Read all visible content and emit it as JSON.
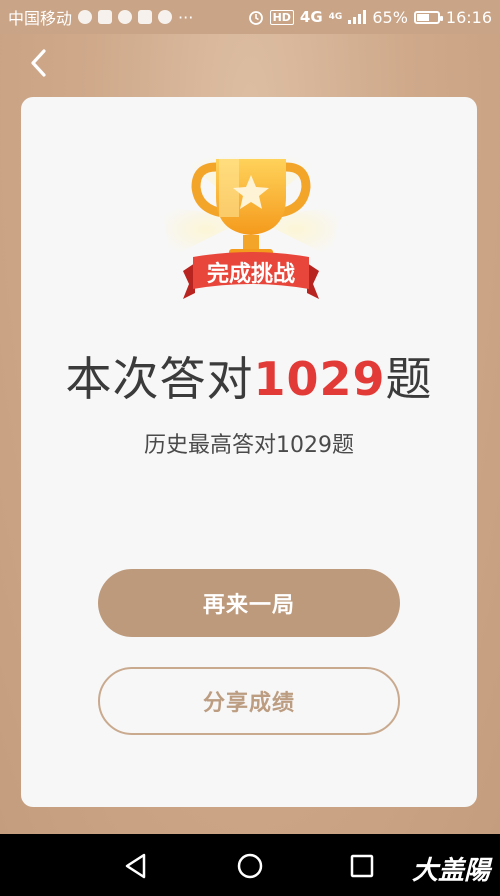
{
  "status_bar": {
    "carrier": "中国移动",
    "more": "···",
    "hd": "HD",
    "network": "4G",
    "network_small": "4G",
    "battery_percent": "65%",
    "battery_level": 0.65,
    "time": "16:16"
  },
  "result": {
    "badge_text": "完成挑战",
    "headline_prefix": "本次答对",
    "headline_count": "1029",
    "headline_suffix": "题",
    "history_text": "历史最高答对1029题"
  },
  "actions": {
    "replay_label": "再来一局",
    "share_label": "分享成绩"
  },
  "nav": {
    "back_icon": "chevron-left-icon",
    "system": [
      "back-triangle-icon",
      "home-circle-icon",
      "recent-square-icon"
    ]
  },
  "watermark": "大盖陽",
  "colors": {
    "background": "#c9a486",
    "card": "#f7f7f7",
    "accent_red": "#e23a36",
    "primary_button": "#bd9a7c",
    "outline_button": "#c9aa8f"
  }
}
